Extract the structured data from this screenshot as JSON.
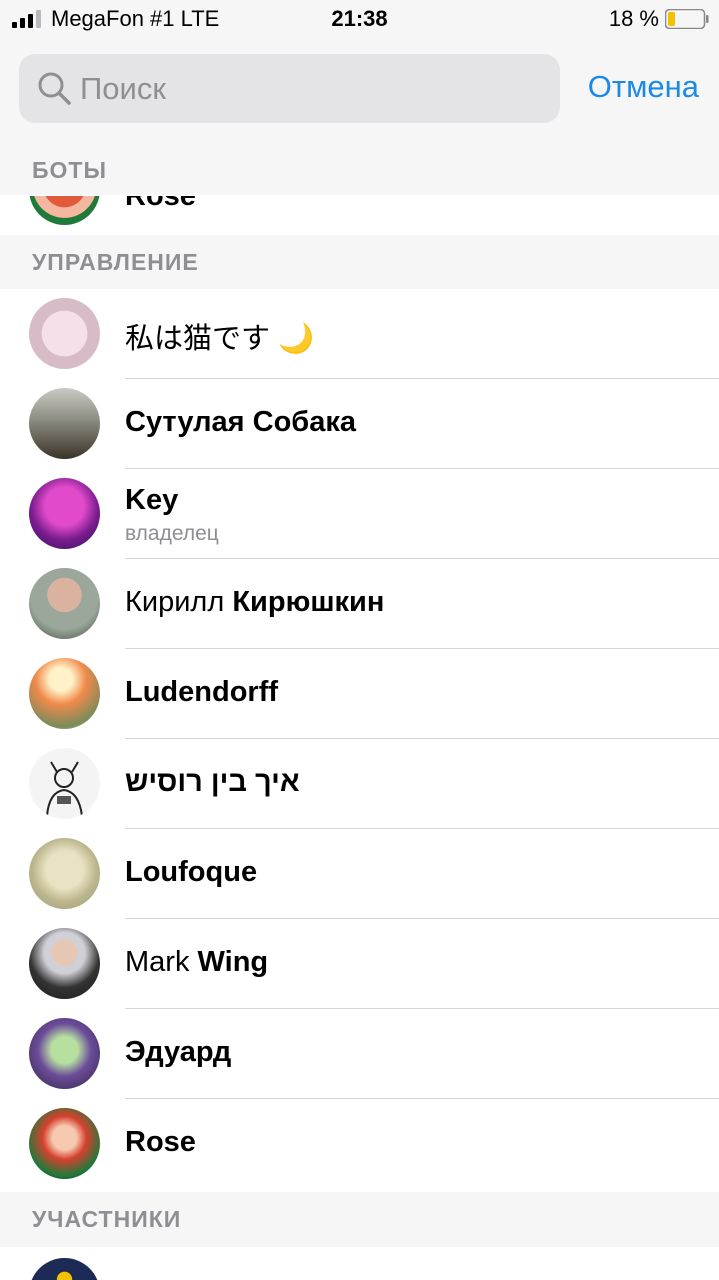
{
  "status": {
    "carrier": "MegaFon #1  LTE",
    "time": "21:38",
    "battery": "18 %"
  },
  "search": {
    "placeholder": "Поиск",
    "cancel_label": "Отмена"
  },
  "sections": {
    "bots": "БОТЫ",
    "admins": "УПРАВЛЕНИЕ",
    "members": "УЧАСТНИКИ"
  },
  "bots_partial_name": "Rose",
  "admins": [
    {
      "first": "私は猫です",
      "last": "",
      "emoji": "🌙",
      "subtitle": "",
      "avatar_color": "#e8c9d6"
    },
    {
      "first": "",
      "last": "Сутулая Собака",
      "emoji": "",
      "subtitle": "",
      "avatar_color": "#6b6a55"
    },
    {
      "first": "",
      "last": "Key",
      "emoji": "",
      "subtitle": "владелец",
      "avatar_color": "#a31f9c"
    },
    {
      "first": "Кирилл",
      "last": "Кирюшкин",
      "emoji": "",
      "subtitle": "",
      "avatar_color": "#7b8a7a"
    },
    {
      "first": "",
      "last": "Ludendorff",
      "emoji": "",
      "subtitle": "",
      "avatar_color": "#e89a5a"
    },
    {
      "first": "",
      "last": "איך בין רוסיש",
      "emoji": "",
      "subtitle": "",
      "avatar_color": "#ededed"
    },
    {
      "first": "",
      "last": "Loufoque",
      "emoji": "",
      "subtitle": "",
      "avatar_color": "#c7c29a"
    },
    {
      "first": "Mark",
      "last": "Wing",
      "emoji": "",
      "subtitle": "",
      "avatar_color": "#3e3a44"
    },
    {
      "first": "",
      "last": "Эдуард",
      "emoji": "",
      "subtitle": "",
      "avatar_color": "#6a5a8a"
    },
    {
      "first": "",
      "last": "Rose",
      "emoji": "",
      "subtitle": "",
      "avatar_color": "#d04a3a"
    }
  ]
}
